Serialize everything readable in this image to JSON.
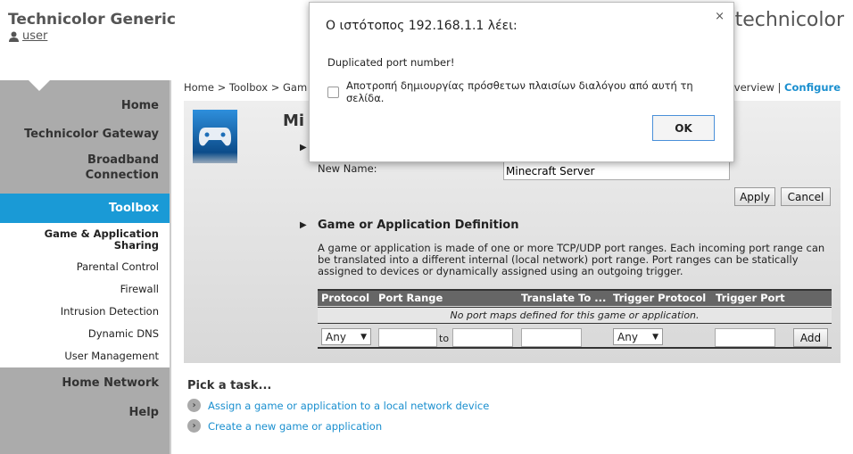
{
  "header": {
    "brand": "Technicolor Generic",
    "user": "user",
    "logo": "technicolor"
  },
  "sidebar": {
    "items": [
      {
        "label": "Home"
      },
      {
        "label": "Technicolor Gateway"
      },
      {
        "label": "Broadband Connection"
      },
      {
        "label": "Toolbox"
      },
      {
        "label": "Home Network"
      },
      {
        "label": "Help"
      }
    ],
    "subitems": [
      {
        "label": "Game & Application Sharing"
      },
      {
        "label": "Parental Control"
      },
      {
        "label": "Firewall"
      },
      {
        "label": "Intrusion Detection"
      },
      {
        "label": "Dynamic DNS"
      },
      {
        "label": "User Management"
      }
    ]
  },
  "breadcrumb": {
    "path": "Home > Toolbox > Gam",
    "overview": "verview",
    "sep": "|",
    "configure": "Configure"
  },
  "main": {
    "title": "Mi",
    "new_name_label": "New Name:",
    "new_name_value": "Minecraft Server",
    "apply": "Apply",
    "cancel": "Cancel",
    "section": "Game or Application Definition",
    "description": "A game or application is made of one or more TCP/UDP port ranges. Each incoming port range can be translated into a different internal (local network) port range. Port ranges can be statically assigned to devices or dynamically assigned using an outgoing trigger.",
    "table": {
      "headers": [
        "Protocol",
        "Port Range",
        "Translate To ...",
        "Trigger Protocol",
        "Trigger Port"
      ],
      "empty": "No port maps defined for this game or application.",
      "protocol": "Any",
      "to": "to",
      "trigger_protocol": "Any",
      "add": "Add"
    }
  },
  "tasks": {
    "title": "Pick a task...",
    "items": [
      "Assign a game or application to a local network device",
      "Create a new game or application"
    ]
  },
  "dialog": {
    "title": "Ο ιστότοπος 192.168.1.1 λέει:",
    "message": "Duplicated port number!",
    "checkbox": "Αποτροπή δημιουργίας πρόσθετων πλαισίων διαλόγου από αυτή τη σελίδα.",
    "ok": "OK",
    "close": "×"
  },
  "colors": {
    "accent": "#1a9ad6",
    "sidebar": "#ababab"
  }
}
